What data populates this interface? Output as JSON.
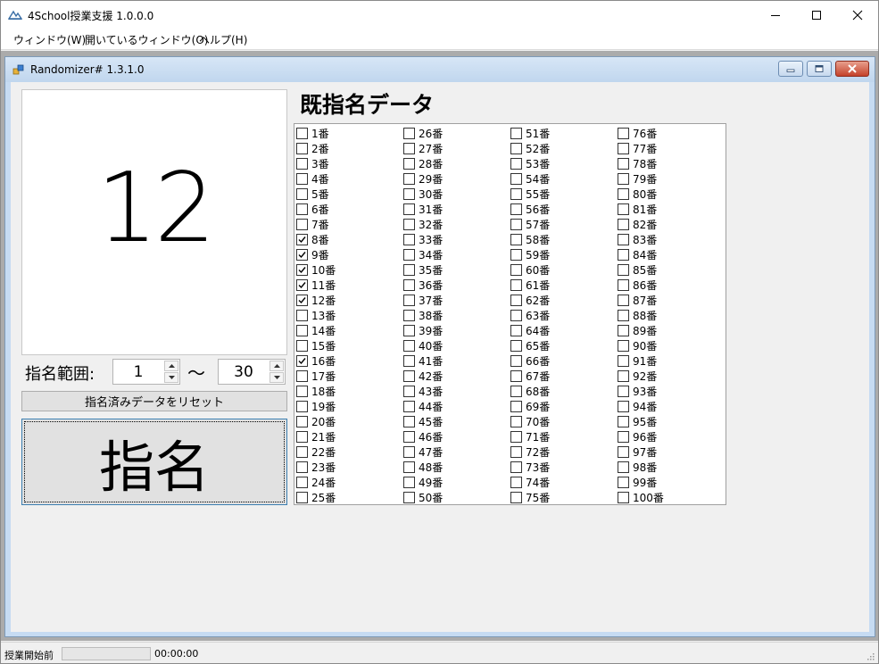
{
  "app": {
    "title": "4School授業支援 1.0.0.0"
  },
  "menu": [
    {
      "label": "ウィンドウ(W)"
    },
    {
      "label": "開いているウィンドウ(O)"
    },
    {
      "label": "ヘルプ(H)"
    }
  ],
  "child": {
    "title": "Randomizer# 1.3.1.0"
  },
  "display": {
    "number": "12"
  },
  "range": {
    "label": "指名範囲:",
    "from": "1",
    "tilde": "〜",
    "to": "30"
  },
  "buttons": {
    "reset_label": "指名済みデータをリセット",
    "call_label": "指名"
  },
  "list": {
    "title": "既指名データ",
    "suffix": "番",
    "checked": [
      8,
      9,
      10,
      11,
      12,
      16
    ],
    "count": 100
  },
  "status": {
    "text": "授業開始前",
    "time": "00:00:00",
    "progress": 0
  },
  "colors": {
    "accent": "#3c7fb1",
    "child_frame": "#c6dbf2",
    "close_button": "#c4412a"
  },
  "icons": [
    "app-icon",
    "minimize-icon",
    "maximize-icon",
    "close-icon",
    "window-icon",
    "spin-up-icon",
    "spin-down-icon",
    "check-icon",
    "size-grip-icon"
  ]
}
